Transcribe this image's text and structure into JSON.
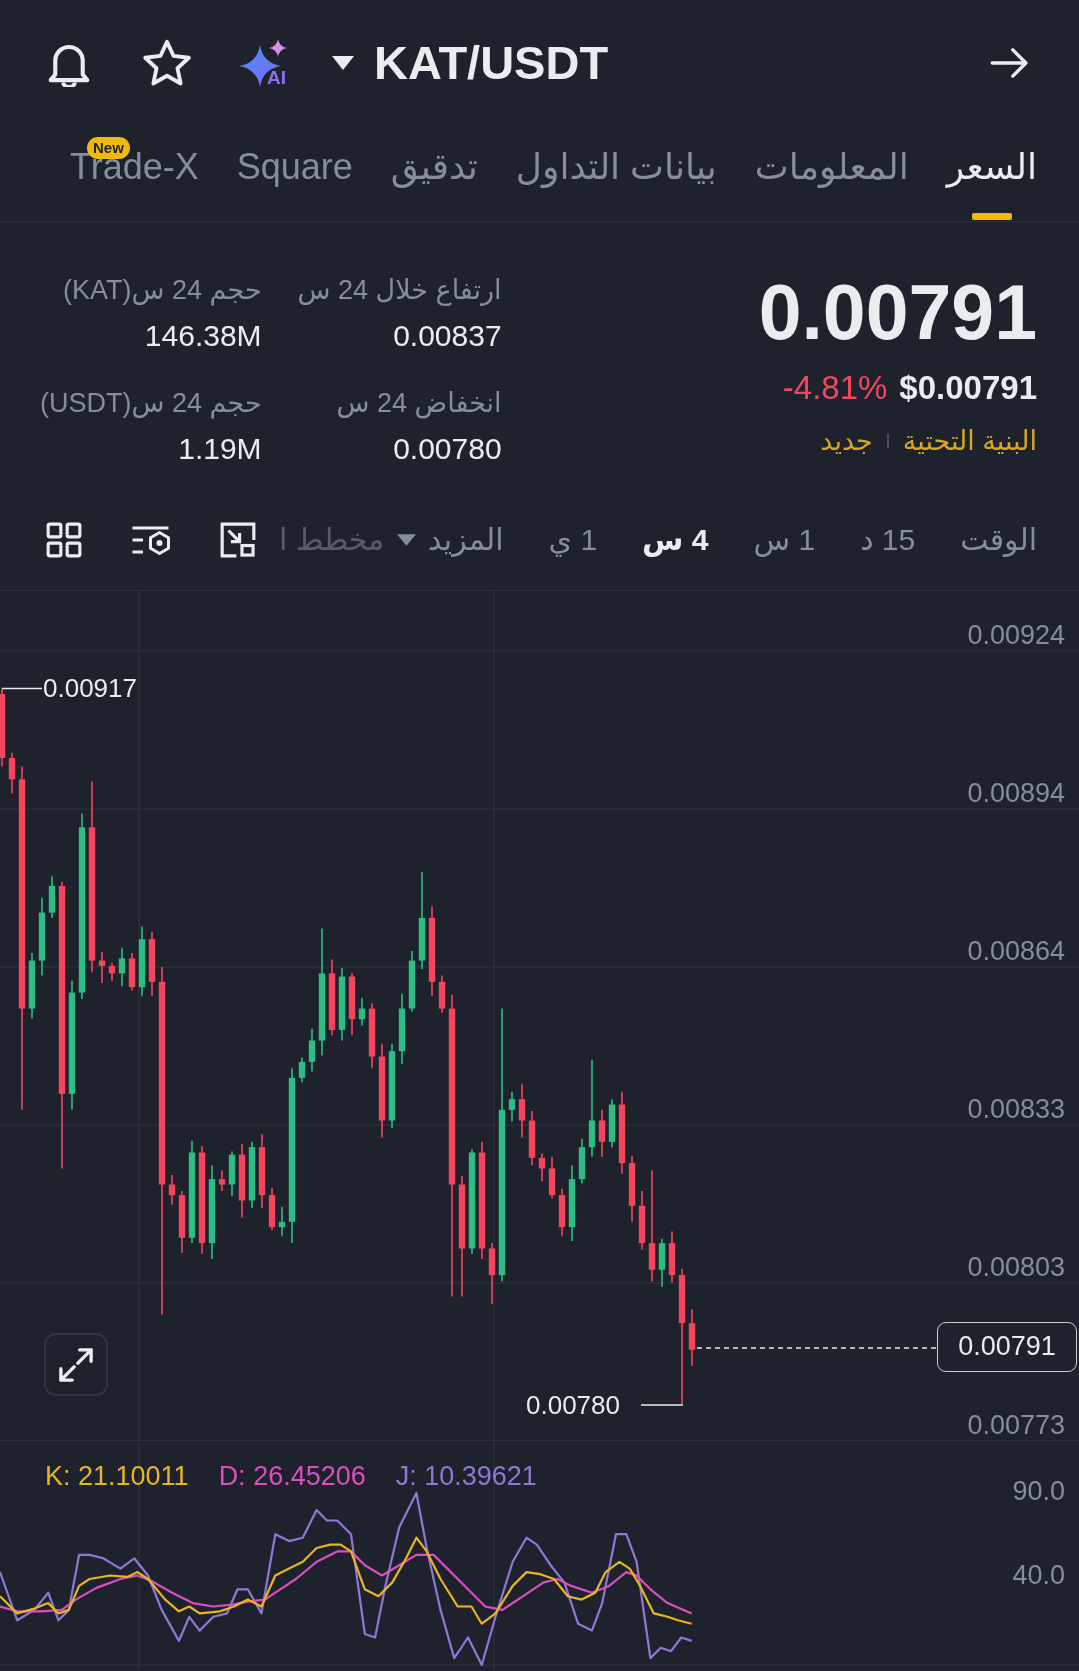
{
  "header": {
    "pair": "KAT/USDT",
    "ai_label": "AI"
  },
  "tabs": [
    {
      "label": "السعر",
      "selected": true
    },
    {
      "label": "المعلومات",
      "selected": false
    },
    {
      "label": "بيانات التداول",
      "selected": false
    },
    {
      "label": "تدقيق",
      "selected": false
    },
    {
      "label": "Square",
      "selected": false
    },
    {
      "label": "Trade-X",
      "selected": false,
      "badge": "New"
    }
  ],
  "ticker": {
    "last_price": "0.00791",
    "usd_price": "$0.00791",
    "change": "-4.81%",
    "tags": [
      "البنية التحتية",
      "جديد"
    ]
  },
  "stats": [
    {
      "label": "ارتفاع خلال 24 س",
      "value": "0.00837"
    },
    {
      "label": "حجم 24 س(KAT)",
      "value": "146.38M"
    },
    {
      "label": "انخفاض 24 س",
      "value": "0.00780"
    },
    {
      "label": "حجم 24 س(USDT)",
      "value": "1.19M"
    }
  ],
  "chart_toolbar": {
    "intervals": [
      {
        "label": "الوقت",
        "selected": false
      },
      {
        "label": "15 د",
        "selected": false
      },
      {
        "label": "1 س",
        "selected": false
      },
      {
        "label": "4 س",
        "selected": true
      },
      {
        "label": "1 ي",
        "selected": false
      }
    ],
    "more": "المزيد",
    "partial_item": "مخطط ا"
  },
  "price_chart": {
    "axis_labels": [
      "0.00924",
      "0.00894",
      "0.00864",
      "0.00833",
      "0.00803",
      "0.00773"
    ],
    "high_label": "0.00917",
    "low_label": "0.00780",
    "current_price": "0.00791"
  },
  "indicator": {
    "series": [
      {
        "label": "J: 10.39621",
        "color": "#9177d4"
      },
      {
        "label": "D: 26.45206",
        "color": "#d94fbf"
      },
      {
        "label": "K: 21.10011",
        "color": "#e8b523"
      }
    ],
    "axis_labels": [
      "90.0",
      "40.0"
    ]
  }
}
